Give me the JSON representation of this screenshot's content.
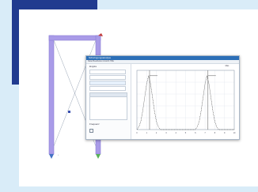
{
  "page": {
    "background": "#d9ecf8",
    "accent_color": "#213b8f",
    "frame_color": "#a99be8"
  },
  "window": {
    "title": "Schwingungsanalyse",
    "toolbar_text": "Datei  Bearbeiten  Ansicht  Hilfe",
    "sidebar": {
      "section_label": "Eingabe",
      "fields": [
        "",
        "",
        "",
        ""
      ],
      "list_header": "",
      "footer_label": "Frequenz"
    },
    "plot": {
      "caption": "Max.",
      "x_ticks": [
        "0",
        "1",
        "2",
        "3",
        "4",
        "5",
        "6",
        "7",
        "8",
        "9",
        "10"
      ]
    }
  },
  "chart_data": {
    "type": "line",
    "x": [
      0,
      0.2,
      0.4,
      0.6,
      0.8,
      1.0,
      1.2,
      1.4,
      1.6,
      1.8,
      2.0,
      2.2,
      2.4,
      2.6,
      2.8,
      3.0,
      3.2,
      3.4,
      3.6,
      3.8,
      4.0,
      4.2,
      4.4,
      4.6,
      4.8,
      5.0,
      5.2,
      5.4,
      5.6,
      5.8,
      6.0,
      6.2,
      6.4,
      6.6,
      6.8,
      7.0,
      7.2,
      7.4,
      7.6,
      7.8,
      8.0,
      8.2,
      8.4,
      8.6,
      8.8,
      9.0,
      9.2,
      9.4,
      9.6,
      9.8,
      10.0
    ],
    "series": [
      {
        "values": [
          0,
          0.05,
          0.15,
          0.35,
          0.6,
          0.85,
          1.0,
          0.85,
          0.6,
          0.35,
          0.15,
          0.05,
          0,
          0,
          0,
          0,
          0,
          0,
          0,
          0,
          0,
          0,
          0,
          0,
          0,
          0,
          0,
          0,
          0,
          0,
          0,
          0.05,
          0.15,
          0.35,
          0.6,
          0.85,
          1.0,
          0.85,
          0.6,
          0.35,
          0.15,
          0.05,
          0,
          0,
          0,
          0,
          0,
          0,
          0,
          0,
          0
        ]
      }
    ],
    "ylim": [
      0,
      1.1
    ],
    "xlim": [
      0,
      10
    ],
    "grid": true,
    "markers": [
      {
        "x": 1.3
      },
      {
        "x": 7.3
      }
    ]
  }
}
